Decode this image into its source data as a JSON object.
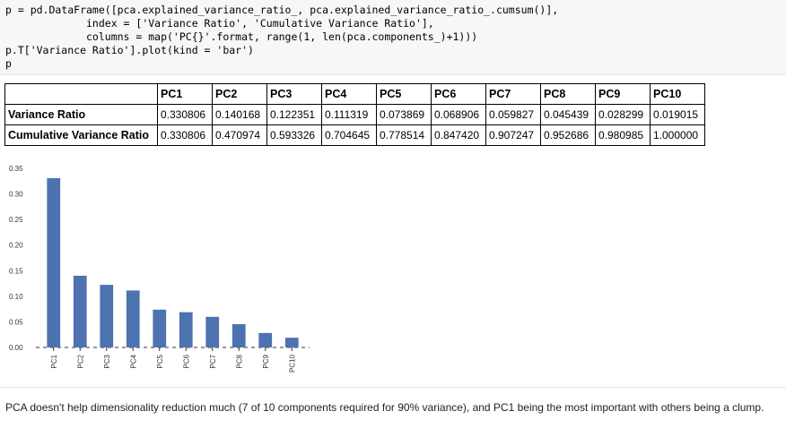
{
  "code_cell": {
    "lines": [
      "p = pd.DataFrame([pca.explained_variance_ratio_, pca.explained_variance_ratio_.cumsum()],",
      "             index = ['Variance Ratio', 'Cumulative Variance Ratio'],",
      "             columns = map('PC{}'.format, range(1, len(pca.components_)+1)))",
      "p.T['Variance Ratio'].plot(kind = 'bar')",
      "p"
    ]
  },
  "dataframe": {
    "columns": [
      "PC1",
      "PC2",
      "PC3",
      "PC4",
      "PC5",
      "PC6",
      "PC7",
      "PC8",
      "PC9",
      "PC10"
    ],
    "rows": [
      {
        "label": "Variance Ratio",
        "values": [
          "0.330806",
          "0.140168",
          "0.122351",
          "0.111319",
          "0.073869",
          "0.068906",
          "0.059827",
          "0.045439",
          "0.028299",
          "0.019015"
        ]
      },
      {
        "label": "Cumulative Variance Ratio",
        "values": [
          "0.330806",
          "0.470974",
          "0.593326",
          "0.704645",
          "0.778514",
          "0.847420",
          "0.907247",
          "0.952686",
          "0.980985",
          "1.000000"
        ]
      }
    ]
  },
  "chart_data": {
    "type": "bar",
    "categories": [
      "PC1",
      "PC2",
      "PC3",
      "PC4",
      "PC5",
      "PC6",
      "PC7",
      "PC8",
      "PC9",
      "PC10"
    ],
    "values": [
      0.330806,
      0.140168,
      0.122351,
      0.111319,
      0.073869,
      0.068906,
      0.059827,
      0.045439,
      0.028299,
      0.019015
    ],
    "yticks": [
      "0.00",
      "0.05",
      "0.10",
      "0.15",
      "0.20",
      "0.25",
      "0.30",
      "0.35"
    ],
    "ylim": [
      0,
      0.35
    ],
    "bar_color": "#4c72b0",
    "grid": false,
    "legend": "none",
    "title": "",
    "xlabel": "",
    "ylabel": ""
  },
  "markdown_cell": {
    "text": "PCA doesn't help dimensionality reduction much (7 of 10 components required for 90% variance), and PC1 being the most important with others being a clump."
  }
}
